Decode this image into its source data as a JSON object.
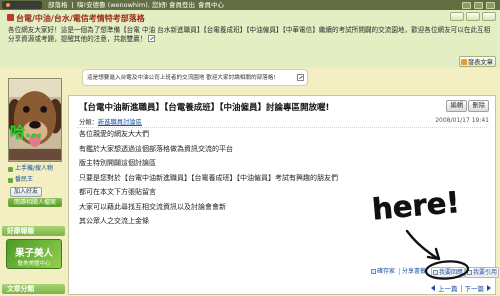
{
  "topbar": {
    "blog_label": "部落格",
    "greeting": "嗨!安德魯 (wenowhim), 您好!",
    "logout": "會員登出",
    "member_center": "會員中心"
  },
  "header": {
    "title": "台電/中油/台水/電信考情特考部落格",
    "description": "各位網友大家好！這是一個為了想準備【台電 中油 台水新進職員】【台電養成班】【中油僱員】【中華電信】繼續的考試所開闢的交流園地，歡迎各位網友可以在此互相分享資源或考題，提醒其他的注意，共創雙贏！",
    "post_button": "發表文章"
  },
  "notice": {
    "text": "這是想要進入台電及中油公司上班者的交流園地 歡迎大家討論相關的部落格!"
  },
  "sidebar": {
    "photo_overlay": "哈...",
    "links": [
      "上手機/搜人物",
      "番民王"
    ],
    "add_friend": "加入好友",
    "profile_button": "閱讀相關人檔案",
    "promo_header": "好康報報",
    "ad": {
      "title": "果子美人",
      "subtitle": "醫美美體中心"
    },
    "categories_header": "文章分類"
  },
  "post": {
    "title": "【台電中油新進職員】【台電養成班】【中油僱員】討論專區開放喔!",
    "edit": "編輯",
    "delete": "刪除",
    "date": "2008/01/17 19:41",
    "category_label": "分類：",
    "category": "新進職員討論區",
    "body": [
      "各位親愛的網友大大們",
      "有鑑於大家想透過這個部落格做為資訊交流的平台",
      "版主特別開闢這個討論區",
      "只要是您對於【台電中油新進職員】【台電養成班】【中油僱員】考試有興趣的朋友們",
      "都可在本文下方張貼留言",
      "大家可以藉此尋找互相交流資訊以及討論會會新",
      "其公眾人之交流上金條"
    ],
    "actions": {
      "save": "確存家",
      "share": "分享書籤",
      "reply": "我要回應",
      "quote": "我要引用"
    },
    "nav": {
      "prev": "上一篇",
      "next": "下一篇"
    }
  },
  "annotation": {
    "text": "here!"
  }
}
